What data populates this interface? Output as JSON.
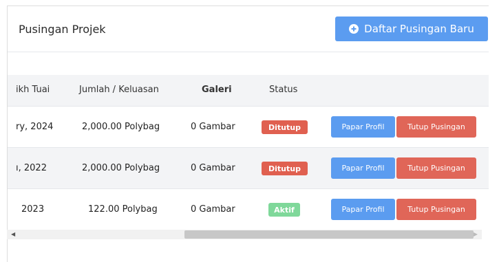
{
  "header": {
    "title": "Pusingan Projek",
    "new_button_label": "Daftar Pusingan Baru"
  },
  "table": {
    "columns": [
      "ikh Tuai",
      "Jumlah / Keluasan",
      "Galeri",
      "Status"
    ],
    "rows": [
      {
        "date": "ry, 2024",
        "amount": "2,000.00 Polybag",
        "gallery": "0 Gambar",
        "status": "Ditutup",
        "view": "Papar Profil",
        "close": "Tutup Pusingan"
      },
      {
        "date": "ı, 2022",
        "amount": "2,000.00 Polybag",
        "gallery": "0 Gambar",
        "status": "Ditutup",
        "view": "Papar Profil",
        "close": "Tutup Pusingan"
      },
      {
        "date": "2023",
        "amount": "122.00 Polybag",
        "gallery": "0 Gambar",
        "status": "Aktif",
        "view": "Papar Profil",
        "close": "Tutup Pusingan"
      }
    ]
  },
  "colors": {
    "primary": "#5b9cf0",
    "danger": "#e06658",
    "status_closed": "#e06050",
    "status_active": "#7fd89a"
  }
}
